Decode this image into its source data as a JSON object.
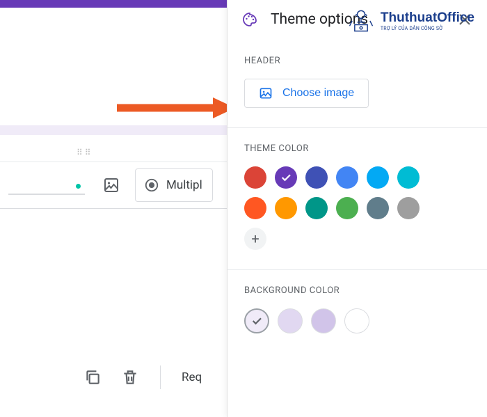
{
  "watermark": {
    "brand": "ThuthuatOffice",
    "tagline": "TRỢ LÝ CỦA DÂN CÔNG SỞ"
  },
  "form": {
    "question_type_label": "Multipl",
    "toolbar": {
      "required_label": "Req"
    }
  },
  "arrow_color": "#ec5a24",
  "theme_panel": {
    "title": "Theme options",
    "sections": {
      "header": {
        "label": "HEADER",
        "button_label": "Choose image"
      },
      "theme_color": {
        "label": "THEME COLOR",
        "selected_index": 1,
        "colors": [
          "#db4437",
          "#673ab7",
          "#3f51b5",
          "#4285f4",
          "#03a9f4",
          "#00bcd4",
          "#ff5722",
          "#ff9800",
          "#009688",
          "#4caf50",
          "#607d8b",
          "#9e9e9e"
        ]
      },
      "background_color": {
        "label": "BACKGROUND COLOR",
        "selected_index": 0,
        "colors": [
          "#f0ebf8",
          "#e1d8f1",
          "#d1c4e9",
          "#ffffff"
        ]
      }
    }
  }
}
